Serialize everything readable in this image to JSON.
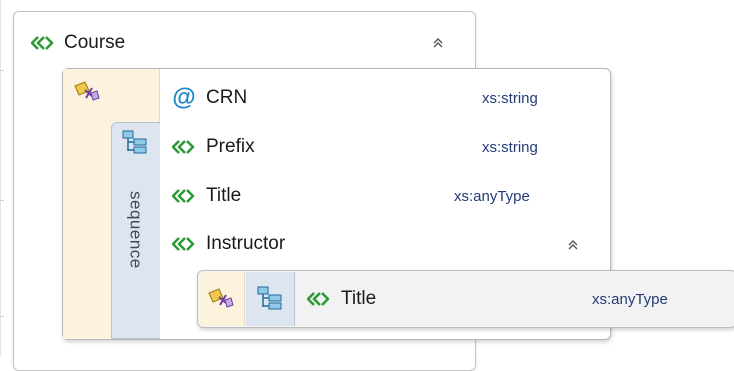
{
  "course": {
    "label": "Course",
    "collapse_glyph": "≈"
  },
  "sequence": {
    "label": "sequence"
  },
  "children": [
    {
      "kind": "attribute",
      "icon": "@",
      "label": "CRN",
      "type": "xs:string"
    },
    {
      "kind": "element",
      "label": "Prefix",
      "type": "xs:string"
    },
    {
      "kind": "element",
      "label": "Title",
      "type": "xs:anyType"
    },
    {
      "kind": "element",
      "label": "Instructor",
      "type": ""
    }
  ],
  "instructor_child": {
    "label": "Title",
    "type": "xs:anyType"
  },
  "colors": {
    "element_green": "#2e9a36",
    "attribute_blue": "#1e88c8",
    "type_text": "#233c78",
    "type_column": "#fbf3dd",
    "sequence_tab": "#dde6f0"
  }
}
